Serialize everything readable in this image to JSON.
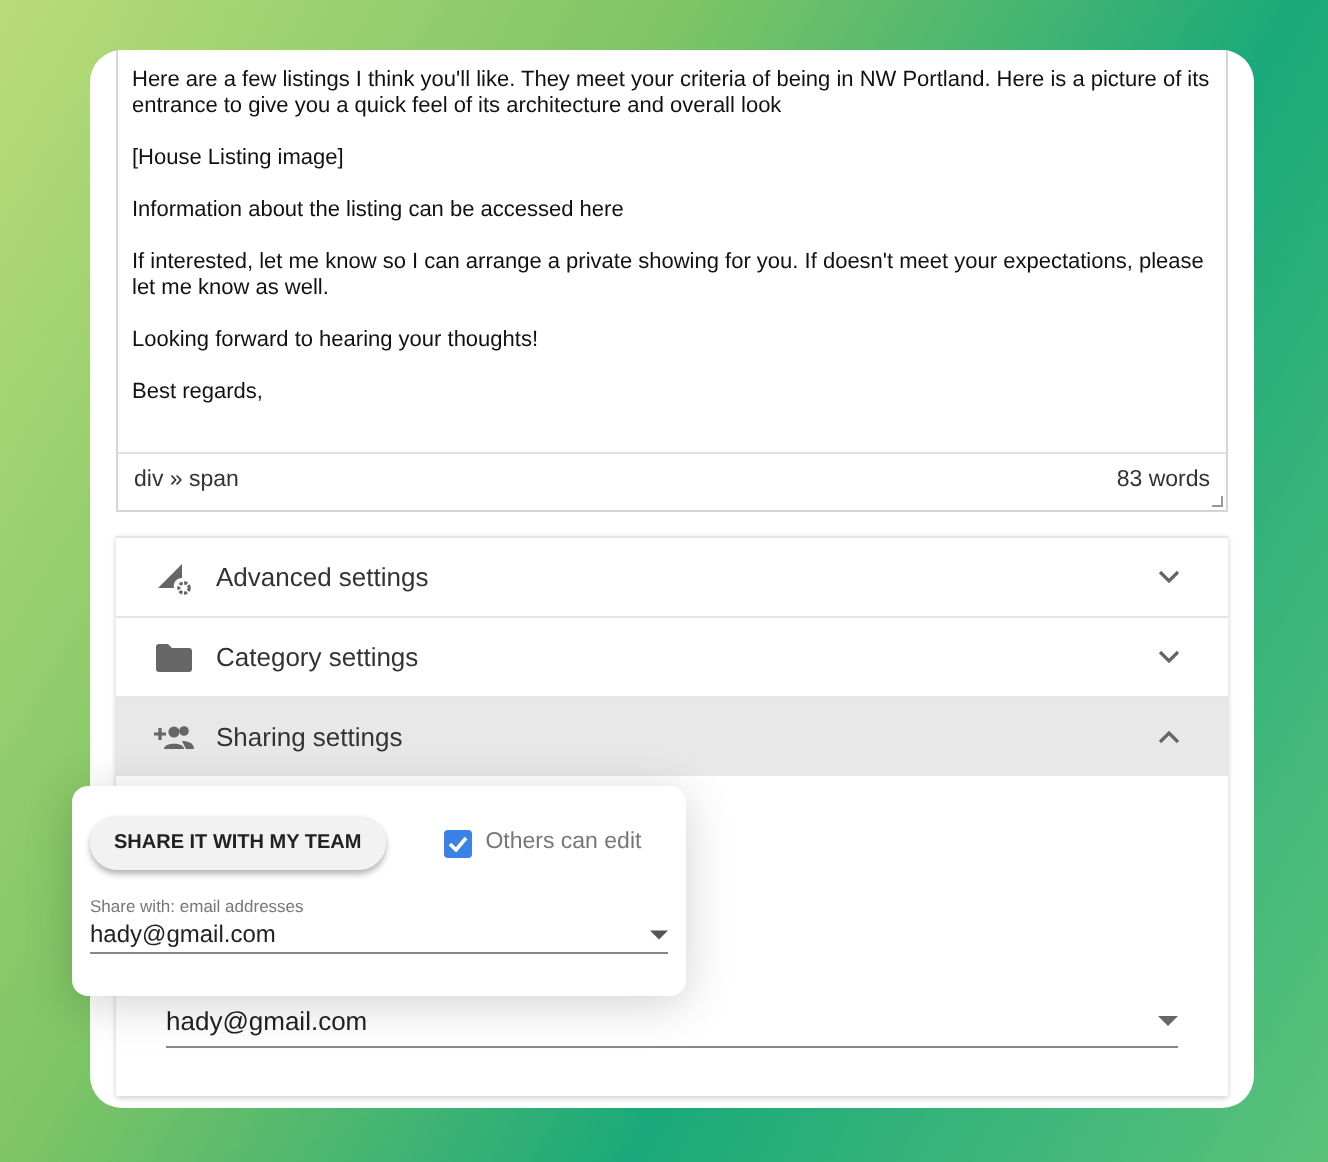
{
  "editor": {
    "paragraphs": [
      "Here are a few listings I think you'll like. They meet your criteria of being in NW Portland. Here is a picture of its entrance to give you a quick feel of its architecture and overall look",
      "[House Listing image]",
      "Information about the listing can be accessed here",
      "If interested, let me know so I can arrange a private showing for you. If doesn't meet your expectations, please let me know as well.",
      "Looking forward to hearing your thoughts!",
      "Best regards,"
    ],
    "path": "div » span",
    "word_count": "83 words"
  },
  "sections": [
    {
      "kind": "advanced",
      "label": "Advanced settings",
      "expanded": false
    },
    {
      "kind": "category",
      "label": "Category settings",
      "expanded": false
    },
    {
      "kind": "sharing",
      "label": "Sharing settings",
      "expanded": true
    }
  ],
  "sharing_panel": {
    "share_with_value": "hady@gmail.com"
  },
  "popup": {
    "button": "SHARE IT WITH MY TEAM",
    "checkbox": {
      "label": "Others can edit",
      "checked": true
    },
    "field": {
      "label": "Share with: email addresses",
      "value": "hady@gmail.com"
    }
  }
}
